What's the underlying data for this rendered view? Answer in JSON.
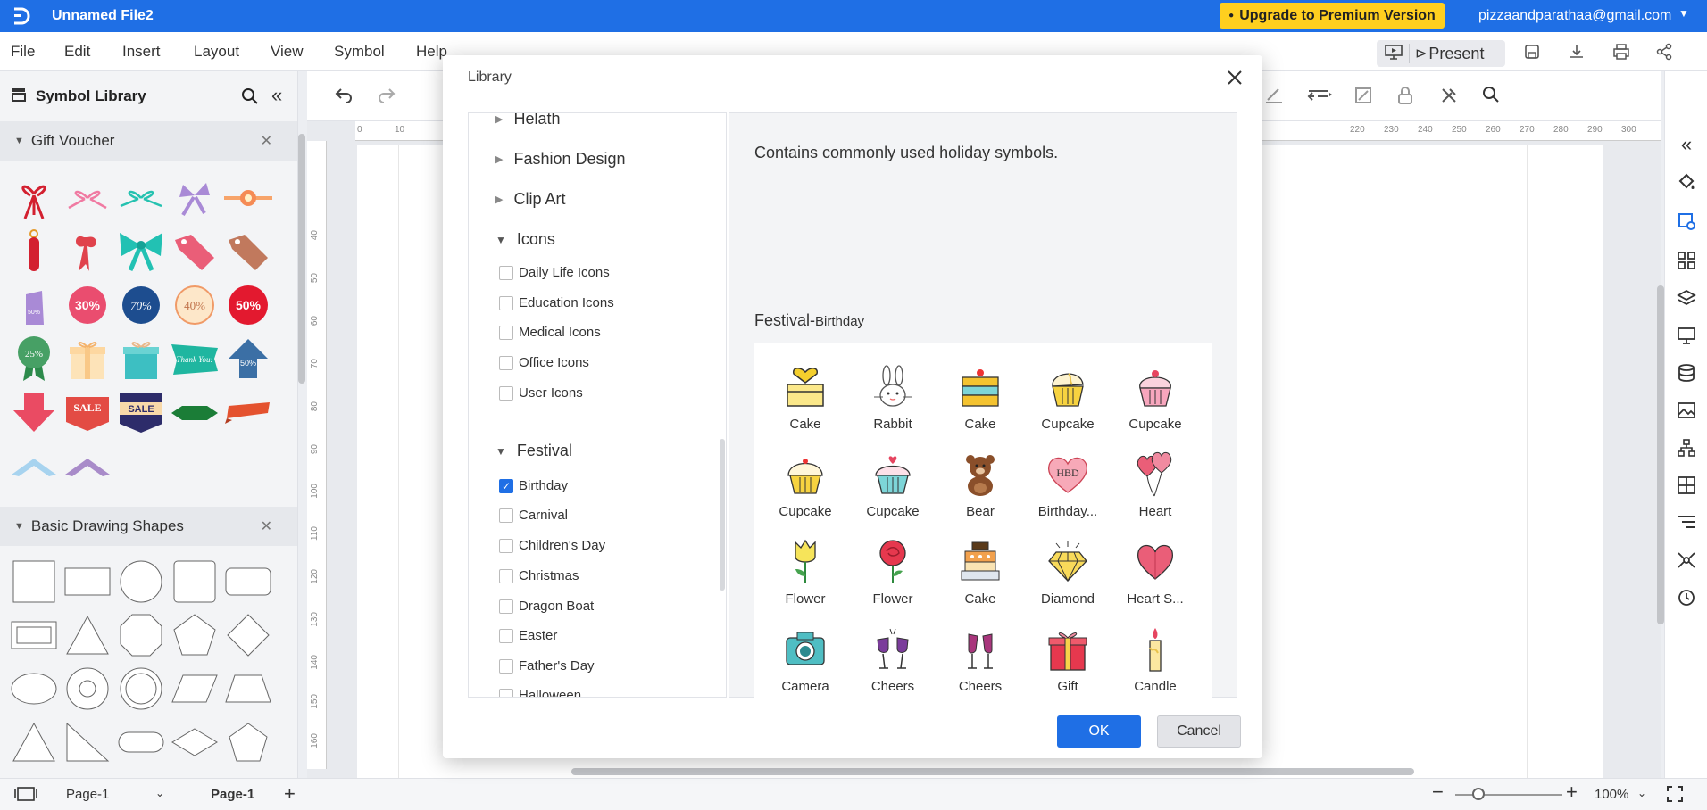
{
  "titlebar": {
    "file_title": "Unnamed File2",
    "upgrade_label": "Upgrade to Premium Version",
    "user_email": "pizzaandparathaa@gmail.com"
  },
  "menu": {
    "items": [
      "File",
      "Edit",
      "Insert",
      "Layout",
      "View",
      "Symbol",
      "Help"
    ],
    "present_label": "Present"
  },
  "left_panel": {
    "title": "Symbol Library",
    "sections": [
      {
        "title": "Gift Voucher"
      },
      {
        "title": "Basic Drawing Shapes"
      }
    ],
    "voucher_texts": [
      "30%",
      "70%",
      "40%",
      "50%",
      "25%",
      "Thank You!",
      "50%",
      "50%",
      "SALE",
      "SALE"
    ]
  },
  "bottombar": {
    "page_select": "Page-1",
    "active_page": "Page-1",
    "zoom": "100%"
  },
  "ruler": {
    "top_ticks": [
      "0",
      "10",
      "220",
      "230",
      "240",
      "250",
      "260",
      "270",
      "280",
      "290",
      "300"
    ],
    "left_ticks": [
      "40",
      "50",
      "60",
      "70",
      "80",
      "90",
      "100",
      "110",
      "120",
      "130",
      "140",
      "150",
      "160",
      "170",
      "180"
    ]
  },
  "modal": {
    "title": "Library",
    "tree": {
      "groups": [
        "Helath",
        "Fashion Design",
        "Clip Art"
      ],
      "icons_group": "Icons",
      "icons_items": [
        "Daily Life Icons",
        "Education Icons",
        "Medical Icons",
        "Office Icons",
        "User Icons"
      ],
      "festival_group": "Festival",
      "festival_items": [
        "Birthday",
        "Carnival",
        "Children's Day",
        "Christmas",
        "Dragon Boat",
        "Easter",
        "Father's Day",
        "Halloween"
      ]
    },
    "description": "Contains commonly used holiday symbols.",
    "category": "Festival-",
    "subcategory": "Birthday",
    "symbols": [
      {
        "label": "Cake",
        "icon": "cake-icon"
      },
      {
        "label": "Rabbit",
        "icon": "rabbit-icon"
      },
      {
        "label": "Cake",
        "icon": "cake-icon"
      },
      {
        "label": "Cupcake",
        "icon": "cupcake-icon"
      },
      {
        "label": "Cupcake",
        "icon": "cupcake-icon"
      },
      {
        "label": "Cupcake",
        "icon": "cupcake-icon"
      },
      {
        "label": "Cupcake",
        "icon": "cupcake-icon"
      },
      {
        "label": "Bear",
        "icon": "bear-icon"
      },
      {
        "label": "Birthday...",
        "icon": "birthday-heart-icon",
        "text": "HBD"
      },
      {
        "label": "Heart",
        "icon": "heart-balloons-icon"
      },
      {
        "label": "Flower",
        "icon": "tulip-icon"
      },
      {
        "label": "Flower",
        "icon": "rose-icon"
      },
      {
        "label": "Cake",
        "icon": "cake-icon"
      },
      {
        "label": "Diamond",
        "icon": "diamond-icon"
      },
      {
        "label": "Heart S...",
        "icon": "heart-icon"
      },
      {
        "label": "Camera",
        "icon": "camera-icon"
      },
      {
        "label": "Cheers",
        "icon": "cheers-icon"
      },
      {
        "label": "Cheers",
        "icon": "cheers-icon"
      },
      {
        "label": "Gift",
        "icon": "gift-icon"
      },
      {
        "label": "Candle",
        "icon": "candle-icon"
      }
    ],
    "ok_label": "OK",
    "cancel_label": "Cancel"
  }
}
